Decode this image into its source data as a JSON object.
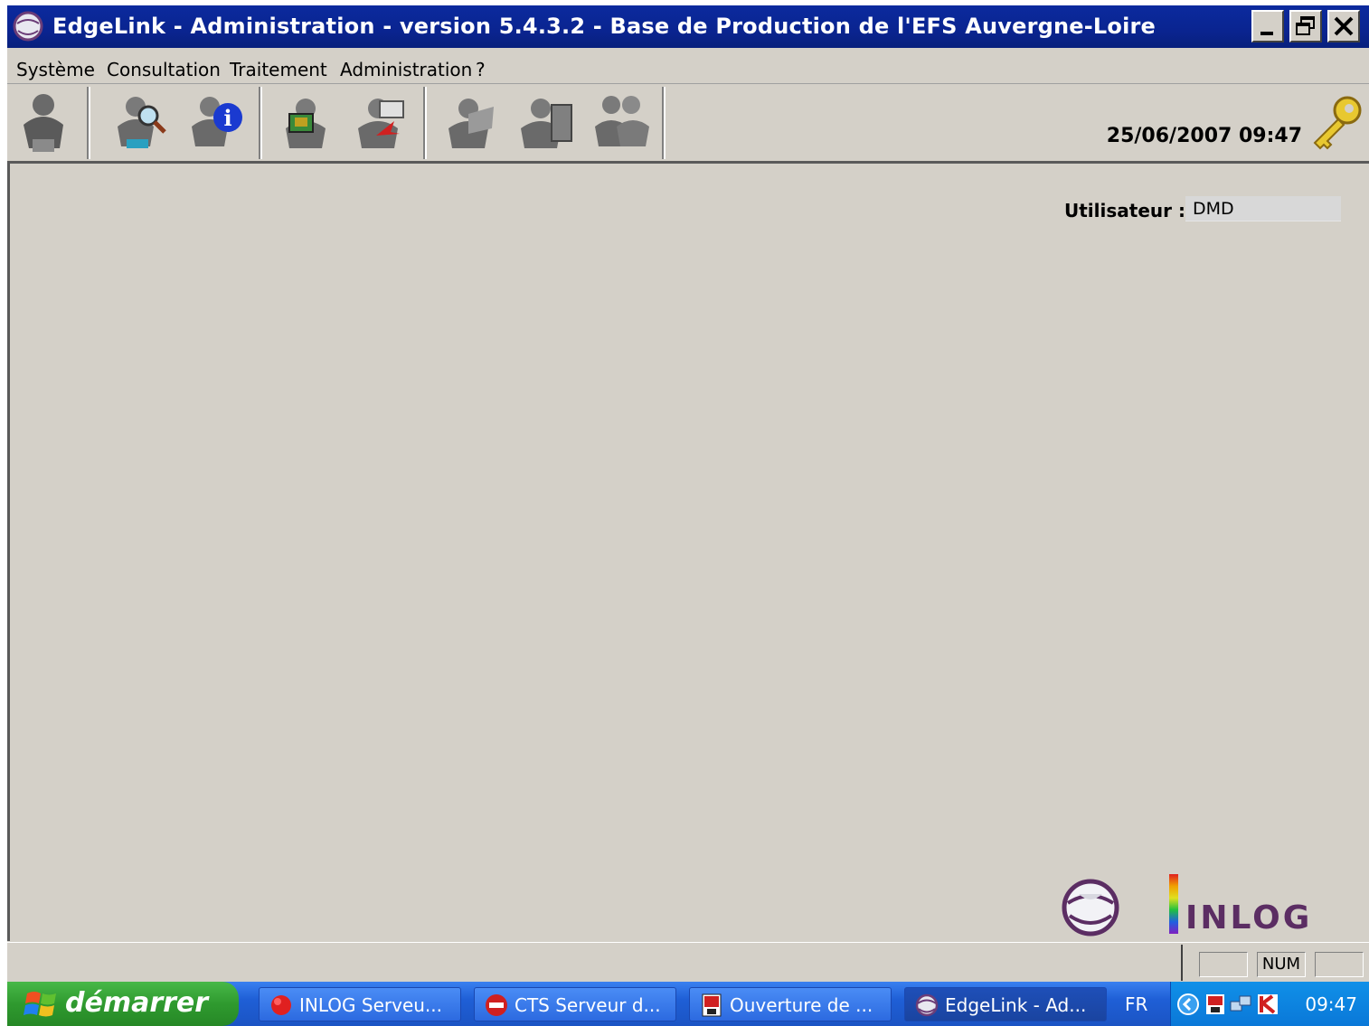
{
  "window": {
    "title": "EdgeLink - Administration - version 5.4.3.2 - Base de Production de l'EFS Auvergne-Loire",
    "controls": {
      "minimize": "_",
      "restore": "🗗",
      "close": "✕"
    }
  },
  "menu": {
    "items": [
      {
        "label": "Système"
      },
      {
        "label": "Consultation"
      },
      {
        "label": "Traitement"
      },
      {
        "label": "Administration"
      },
      {
        "label": "?"
      }
    ]
  },
  "toolbar": {
    "buttons": [
      {
        "icon": "person-icon"
      },
      {
        "icon": "search-person-icon"
      },
      {
        "icon": "info-person-icon"
      },
      {
        "icon": "screen-person-icon"
      },
      {
        "icon": "send-person-icon"
      },
      {
        "icon": "folder-person-icon"
      },
      {
        "icon": "server-person-icon"
      },
      {
        "icon": "group-person-icon"
      }
    ],
    "datetime": "25/06/2007 09:47",
    "key_icon": "key-icon"
  },
  "main": {
    "user_label": "Utilisateur :",
    "user_value": "DMD",
    "logo_text": "INLOG"
  },
  "statusbar": {
    "panels": [
      "",
      "NUM",
      ""
    ]
  },
  "taskbar": {
    "start_label": "démarrer",
    "tasks": [
      {
        "label": "INLOG Serveu...",
        "icon": "inlog-server-icon",
        "active": false
      },
      {
        "label": "CTS Serveur d...",
        "icon": "cts-icon",
        "active": false
      },
      {
        "label": "Ouverture de ...",
        "icon": "red-window-icon",
        "active": false
      },
      {
        "label": "EdgeLink - Ad...",
        "icon": "edgelink-globe-icon",
        "active": true
      }
    ],
    "language": "FR",
    "clock": "09:47"
  },
  "colors": {
    "titlebar": "#0a2490",
    "window_bg": "#d4d0c8",
    "taskbar": "#2c6ae0",
    "start_button": "#2f9a2f",
    "logo_purple": "#5b2d63"
  }
}
